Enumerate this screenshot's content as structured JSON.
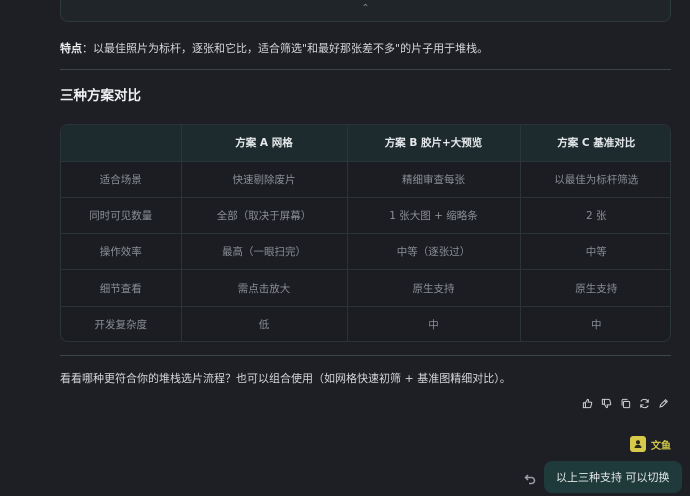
{
  "feature": {
    "label": "特点",
    "text": "：以最佳照片为标杆，逐张和它比，适合筛选\"和最好那张差不多\"的片子用于堆栈。"
  },
  "section_title": "三种方案对比",
  "table": {
    "headers": [
      "",
      "方案 A 网格",
      "方案 B 胶片+大预览",
      "方案 C 基准对比"
    ],
    "rows": [
      [
        "适合场景",
        "快速剔除废片",
        "精细审查每张",
        "以最佳为标杆筛选"
      ],
      [
        "同时可见数量",
        "全部（取决于屏幕）",
        "1 张大图 + 缩略条",
        "2 张"
      ],
      [
        "操作效率",
        "最高（一眼扫完）",
        "中等（逐张过）",
        "中等"
      ],
      [
        "细节查看",
        "需点击放大",
        "原生支持",
        "原生支持"
      ],
      [
        "开发复杂度",
        "低",
        "中",
        "中"
      ]
    ]
  },
  "summary": "看看哪种更符合你的堆栈选片流程？也可以组合使用（如网格快速初筛 + 基准图精细对比）。",
  "actions": [
    "thumbs-up-icon",
    "thumbs-down-icon",
    "copy-icon",
    "refresh-icon",
    "edit-icon"
  ],
  "user": {
    "name": "文鱼",
    "message": "以上三种支持 可以切换"
  },
  "colors": {
    "background": "#1d1f24",
    "table_header": "#1e2b2e",
    "bubble": "#1f3a3a",
    "user_accent": "#cfc54a"
  }
}
